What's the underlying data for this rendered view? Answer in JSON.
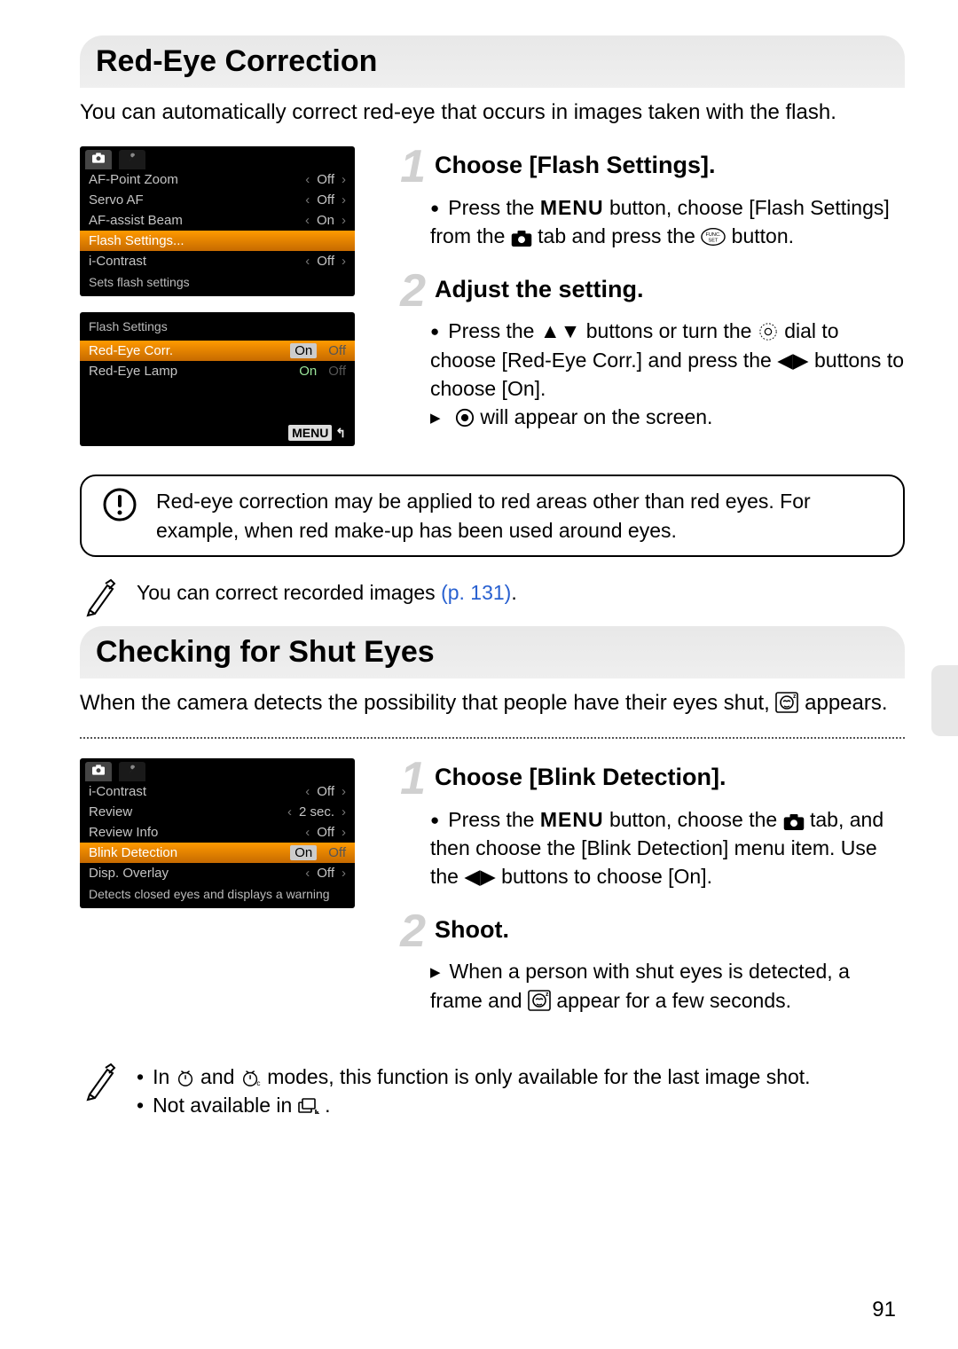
{
  "page_number": "91",
  "section1": {
    "heading": "Red-Eye Correction",
    "intro": "You can automatically correct red-eye that occurs in images taken with the flash.",
    "lcd1": {
      "rows": [
        {
          "label": "AF-Point Zoom",
          "value": "Off"
        },
        {
          "label": "Servo AF",
          "value": "Off"
        },
        {
          "label": "AF-assist Beam",
          "value": "On"
        },
        {
          "label": "Flash Settings...",
          "value": "",
          "sel": true
        },
        {
          "label": "i-Contrast",
          "value": "Off"
        }
      ],
      "status": "Sets flash settings"
    },
    "lcd2": {
      "title": "Flash Settings",
      "rows": [
        {
          "label": "Red-Eye Corr.",
          "on": true,
          "sel": true
        },
        {
          "label": "Red-Eye Lamp",
          "on": true,
          "sel": false
        }
      ],
      "menu_label": "MENU"
    },
    "step1": {
      "num": "1",
      "title": "Choose [Flash Settings].",
      "body_a": "Press the ",
      "body_b": " button, choose [Flash Settings] from the ",
      "body_c": " tab and press the ",
      "body_d": " button."
    },
    "step2": {
      "num": "2",
      "title": "Adjust the setting.",
      "body_a": "Press the ",
      "body_b": " buttons or turn the ",
      "body_c": " dial to choose [Red-Eye Corr.] and press the ",
      "body_d": " buttons to choose [On].",
      "result": " will appear on the screen."
    },
    "warning": "Red-eye correction may be applied to red areas other than red eyes. For example, when red make-up has been used around eyes.",
    "tip_a": "You can correct recorded images ",
    "tip_link": "(p. 131)",
    "tip_b": "."
  },
  "section2": {
    "heading": "Checking for Shut Eyes",
    "intro_a": "When the camera detects the possibility that people have their eyes shut, ",
    "intro_b": " appears.",
    "lcd": {
      "rows": [
        {
          "label": "i-Contrast",
          "value": "Off"
        },
        {
          "label": "Review",
          "value": "2 sec."
        },
        {
          "label": "Review Info",
          "value": "Off"
        },
        {
          "label": "Blink Detection",
          "on": true,
          "sel": true
        },
        {
          "label": "Disp. Overlay",
          "value": "Off"
        }
      ],
      "status": "Detects closed eyes and displays a warning"
    },
    "step1": {
      "num": "1",
      "title": "Choose [Blink Detection].",
      "body_a": "Press the ",
      "body_b": " button, choose the ",
      "body_c": " tab, and then choose the [Blink Detection] menu item. Use the ",
      "body_d": " buttons to choose [On]."
    },
    "step2": {
      "num": "2",
      "title": "Shoot.",
      "result_a": "When a person with shut eyes is detected, a frame and ",
      "result_b": " appear for a few seconds."
    },
    "tips": {
      "t1_a": "In ",
      "t1_b": " and ",
      "t1_c": " modes, this function is only available for the last image shot.",
      "t2_a": "Not available in ",
      "t2_b": "."
    }
  }
}
